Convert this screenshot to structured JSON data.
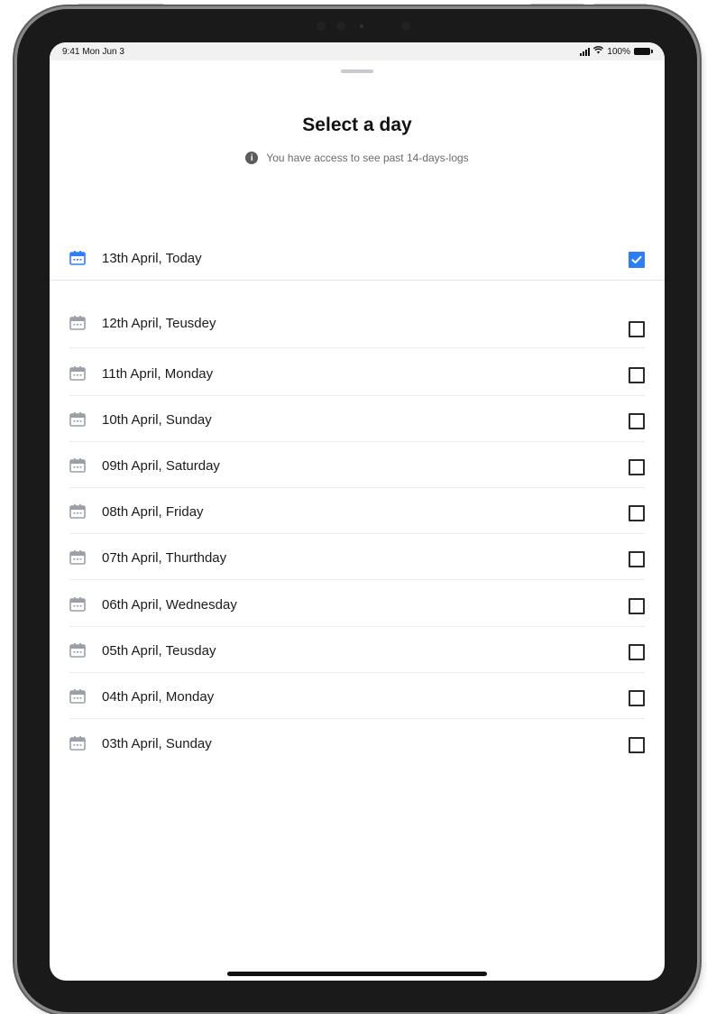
{
  "status_bar": {
    "time": "9:41 Mon Jun 3",
    "battery": "100%"
  },
  "sheet": {
    "title": "Select a day",
    "notice": "You have access to see past 14-days-logs"
  },
  "colors": {
    "accent": "#2f7df6",
    "icon_gray": "#9aa0a6"
  },
  "days": [
    {
      "label": "13th April, Today",
      "checked": true
    },
    {
      "label": "12th April, Teusdey",
      "checked": false
    },
    {
      "label": "11th April, Monday",
      "checked": false
    },
    {
      "label": "10th April, Sunday",
      "checked": false
    },
    {
      "label": "09th April, Saturday",
      "checked": false
    },
    {
      "label": "08th April, Friday",
      "checked": false
    },
    {
      "label": "07th April, Thurthday",
      "checked": false
    },
    {
      "label": "06th April, Wednesday",
      "checked": false
    },
    {
      "label": "05th April, Teusday",
      "checked": false
    },
    {
      "label": "04th April, Monday",
      "checked": false
    },
    {
      "label": "03th April, Sunday",
      "checked": false
    }
  ]
}
